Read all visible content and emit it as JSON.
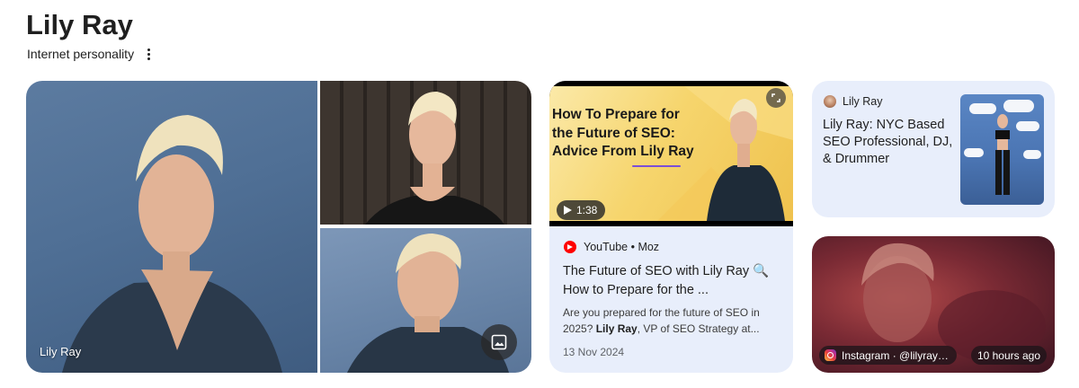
{
  "entity": {
    "name": "Lily Ray",
    "type": "Internet personality"
  },
  "images": {
    "label": "Lily Ray"
  },
  "video_card": {
    "thumbnail_text": "How To Prepare for\nthe Future of SEO:\nAdvice From Lily Ray",
    "duration": "1:38",
    "source": "YouTube • Moz",
    "title": "The Future of SEO with Lily Ray 🔍 How to Prepare for the ...",
    "description_prefix": "Are you prepared for the future of SEO in 2025? ",
    "description_bold": "Lily Ray",
    "description_suffix": ", VP of SEO Strategy at...",
    "date": "13 Nov 2024"
  },
  "article_card": {
    "source": "Lily Ray",
    "title": "Lily Ray: NYC Based SEO Professional, DJ, & Drummer"
  },
  "instagram_card": {
    "source": "Instagram · @lilyray…",
    "time": "10 hours ago"
  },
  "icons": {
    "more": "more-vert-icon",
    "images": "image-icon",
    "expand": "expand-icon",
    "play": "play-icon",
    "youtube": "youtube-icon",
    "instagram": "instagram-icon"
  },
  "colors": {
    "card_bg": "#e8eefb",
    "youtube_red": "#ff0000"
  }
}
